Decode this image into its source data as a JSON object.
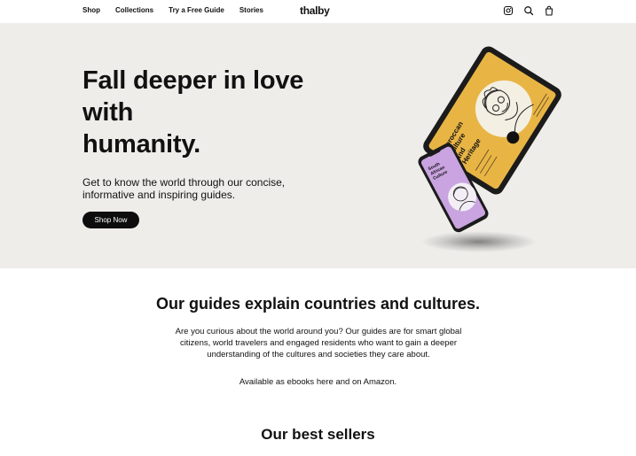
{
  "header": {
    "nav": [
      "Shop",
      "Collections",
      "Try a Free Guide",
      "Stories"
    ],
    "logo": "thalby",
    "icons": [
      "instagram-icon",
      "search-icon",
      "shopping-bag-icon"
    ]
  },
  "hero": {
    "title_line1": "Fall deeper in love",
    "title_line2": "with",
    "title_line3": "humanity.",
    "subtitle": "Get to know the world through our concise, informative and inspiring guides.",
    "cta": "Shop Now",
    "tablet_title_lines": [
      "Moroccan",
      "Culture",
      "and",
      "Heritage"
    ],
    "phone_title_lines": [
      "South",
      "African",
      "Culture"
    ],
    "colors": {
      "background": "#efedea",
      "tablet_cover": "#e8b545",
      "phone_cover": "#c9a4e0",
      "button": "#0d0d0d"
    }
  },
  "intro": {
    "title": "Our guides explain countries and cultures.",
    "body": "Are you curious about the world around you? Our guides are for smart global citizens, world travelers and engaged residents who want to gain a deeper understanding of the cultures and societies they care about.",
    "availability": "Available as ebooks here and on Amazon."
  },
  "best_sellers": {
    "title": "Our best sellers"
  }
}
